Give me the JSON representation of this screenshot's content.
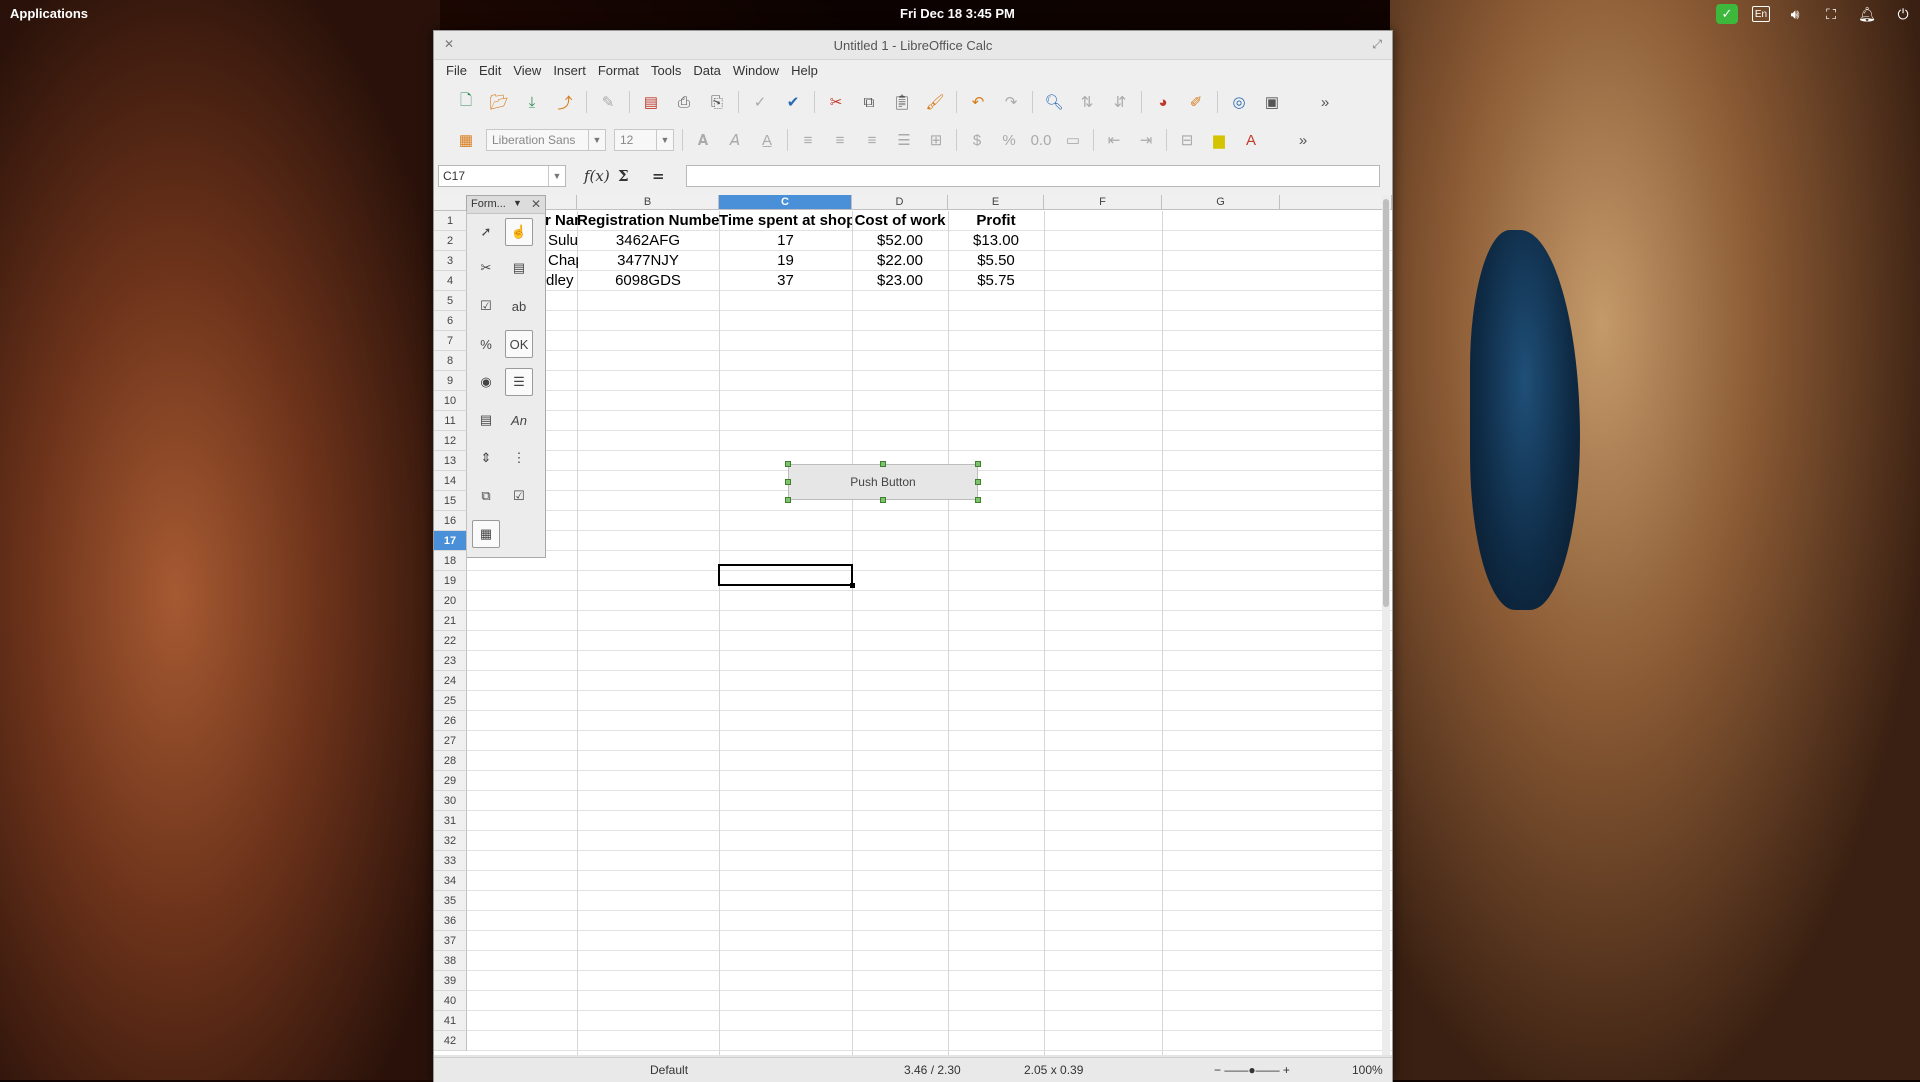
{
  "desktop": {
    "applications_label": "Applications",
    "clock": "Fri Dec 18    3:45 PM",
    "tray": {
      "lang": "En"
    }
  },
  "window": {
    "title": "Untitled 1 - LibreOffice Calc",
    "menu": [
      "File",
      "Edit",
      "View",
      "Insert",
      "Format",
      "Tools",
      "Data",
      "Window",
      "Help"
    ]
  },
  "toolbar2": {
    "font_name": "Liberation Sans",
    "font_size": "12"
  },
  "formula_bar": {
    "name_box": "C17",
    "formula": ""
  },
  "form_controls_toolbar": {
    "title": "Form..."
  },
  "sheet": {
    "columns": [
      "B",
      "C",
      "D",
      "E",
      "F",
      "G"
    ],
    "selected_column": "C",
    "selected_row": "17",
    "rows": [
      "1",
      "2",
      "3",
      "4",
      "5",
      "6",
      "7",
      "8",
      "9",
      "10",
      "11",
      "12",
      "13",
      "14",
      "15",
      "16",
      "17",
      "18",
      "19",
      "20",
      "21",
      "22",
      "23",
      "24",
      "25",
      "26",
      "27",
      "28",
      "29",
      "30",
      "31",
      "32",
      "33",
      "34",
      "35",
      "36",
      "37",
      "38",
      "39",
      "40",
      "41",
      "42"
    ],
    "headers": [
      "r Name",
      "Registration Number",
      "Time spent at shop",
      "Cost of work",
      "Profit"
    ],
    "data": [
      [
        "Sulu",
        "3462AFG",
        "17",
        "$52.00",
        "$13.00"
      ],
      [
        "Chapel",
        "3477NJY",
        "19",
        "$22.00",
        "$5.50"
      ],
      [
        "dley",
        "6098GDS",
        "37",
        "$23.00",
        "$5.75"
      ]
    ],
    "push_button_label": "Push Button"
  },
  "status_bar": {
    "page_style": "Default",
    "position": "3.46 / 2.30",
    "size": "2.05 x 0.39",
    "zoom": "100%"
  }
}
